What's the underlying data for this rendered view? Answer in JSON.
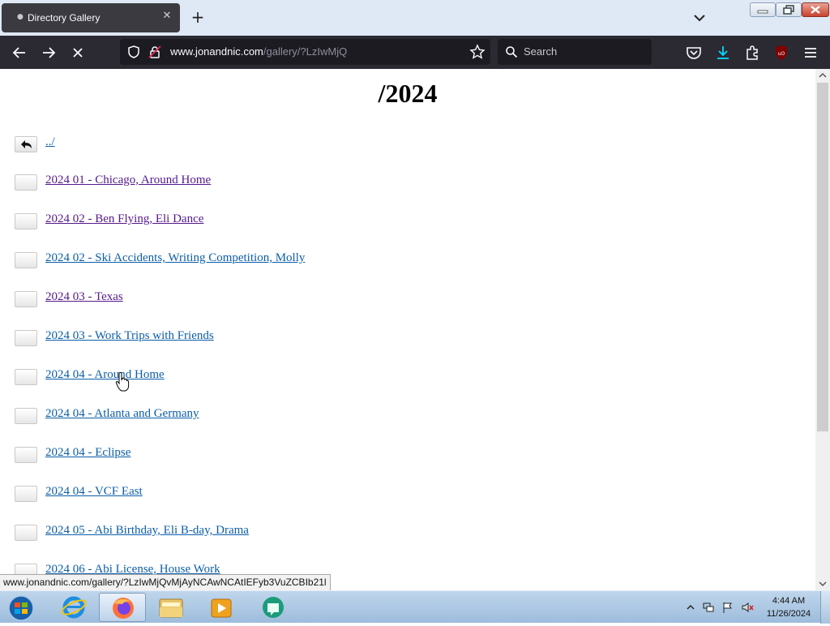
{
  "browser": {
    "tab_title": "Directory Gallery",
    "url_host": "www.jonandnic.com",
    "url_path": "/gallery/?LzIwMjQ",
    "search_placeholder": "Search"
  },
  "page": {
    "heading": "/2024",
    "parent_link": "../",
    "folders": [
      {
        "label": "2024 01 - Chicago, Around Home",
        "visited": true
      },
      {
        "label": "2024 02 - Ben Flying, Eli Dance",
        "visited": true
      },
      {
        "label": "2024 02 - Ski Accidents, Writing Competition, Molly",
        "visited": false
      },
      {
        "label": "2024 03 - Texas",
        "visited": true
      },
      {
        "label": "2024 03 - Work Trips with Friends",
        "visited": false
      },
      {
        "label": "2024 04 - Around Home",
        "visited": false
      },
      {
        "label": "2024 04 - Atlanta and Germany",
        "visited": false
      },
      {
        "label": "2024 04 - Eclipse",
        "visited": false
      },
      {
        "label": "2024 04 - VCF East",
        "visited": false
      },
      {
        "label": "2024 05 - Abi Birthday, Eli B-day, Drama",
        "visited": false
      },
      {
        "label": "2024 06 - Abi License, House Work",
        "visited": false
      }
    ],
    "link_colors": {
      "visited": "#551a8b",
      "unvisited": "#0d5ea8"
    }
  },
  "status_url": "www.jonandnic.com/gallery/?LzIwMjQvMjAyNCAwNCAtIEFyb3VuZCBIb21l",
  "taskbar": {
    "time": "4:44 AM",
    "date": "11/26/2024",
    "apps": [
      "start-orb-icon",
      "internet-explorer-icon",
      "firefox-icon",
      "file-explorer-icon",
      "media-player-icon",
      "app-icon"
    ]
  },
  "theme": {
    "toolbar_bg": "#2b2a33",
    "field_bg": "#1c1b22",
    "download_accent": "#00ddff",
    "ublock_red": "#800000"
  }
}
